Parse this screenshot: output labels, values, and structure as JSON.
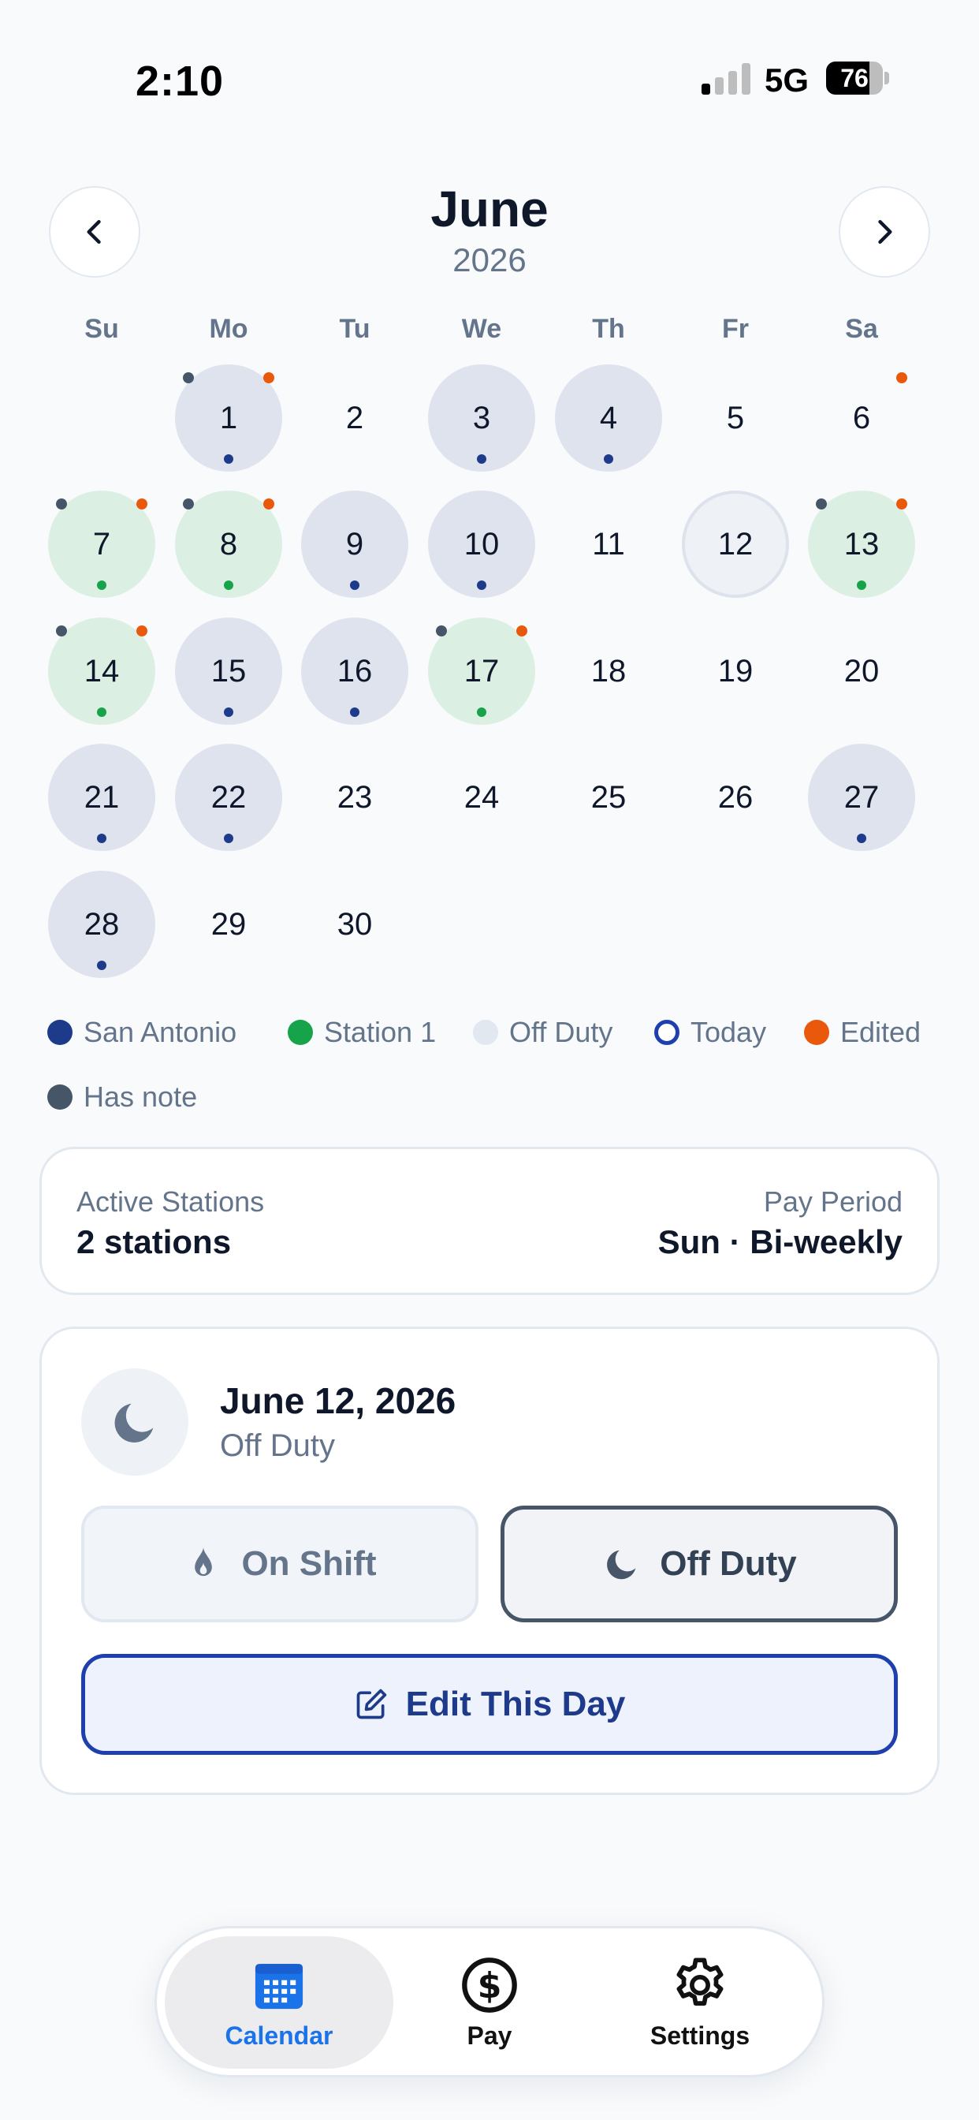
{
  "status_bar": {
    "time": "2:10",
    "network": "5G",
    "battery": "76",
    "battery_level": 0.76
  },
  "header": {
    "month": "June",
    "year": "2026"
  },
  "weekdays": [
    "Su",
    "Mo",
    "Tu",
    "We",
    "Th",
    "Fr",
    "Sa"
  ],
  "calendar": {
    "days": [
      {
        "n": "1",
        "type": "blue",
        "note": true,
        "edited": true
      },
      {
        "n": "2",
        "type": "none"
      },
      {
        "n": "3",
        "type": "blue"
      },
      {
        "n": "4",
        "type": "blue"
      },
      {
        "n": "5",
        "type": "none"
      },
      {
        "n": "6",
        "type": "none",
        "edited": true
      },
      {
        "n": "7",
        "type": "green",
        "note": true,
        "edited": true
      },
      {
        "n": "8",
        "type": "green",
        "note": true,
        "edited": true
      },
      {
        "n": "9",
        "type": "blue"
      },
      {
        "n": "10",
        "type": "blue"
      },
      {
        "n": "11",
        "type": "none"
      },
      {
        "n": "12",
        "type": "selected"
      },
      {
        "n": "13",
        "type": "green",
        "note": true,
        "edited": true
      },
      {
        "n": "14",
        "type": "green",
        "note": true,
        "edited": true
      },
      {
        "n": "15",
        "type": "blue"
      },
      {
        "n": "16",
        "type": "blue"
      },
      {
        "n": "17",
        "type": "green",
        "note": true,
        "edited": true
      },
      {
        "n": "18",
        "type": "none"
      },
      {
        "n": "19",
        "type": "none"
      },
      {
        "n": "20",
        "type": "none"
      },
      {
        "n": "21",
        "type": "blue"
      },
      {
        "n": "22",
        "type": "blue"
      },
      {
        "n": "23",
        "type": "none"
      },
      {
        "n": "24",
        "type": "none"
      },
      {
        "n": "25",
        "type": "none"
      },
      {
        "n": "26",
        "type": "none"
      },
      {
        "n": "27",
        "type": "blue"
      },
      {
        "n": "28",
        "type": "blue"
      },
      {
        "n": "29",
        "type": "none"
      },
      {
        "n": "30",
        "type": "none"
      }
    ],
    "first_weekday": 1
  },
  "legend": {
    "san_antonio": "San Antonio",
    "station1": "Station 1",
    "off_duty": "Off Duty",
    "today": "Today",
    "edited": "Edited",
    "has_note": "Has note"
  },
  "colors": {
    "san_antonio": "#1e3a8a",
    "station1": "#16a34a",
    "off_duty": "#e2e8f0",
    "today": "#1e40af",
    "edited": "#ea580c",
    "note": "#475569"
  },
  "info": {
    "active_label": "Active Stations",
    "active_value": "2 stations",
    "pay_label": "Pay Period",
    "pay_value": "Sun · Bi-weekly"
  },
  "detail": {
    "icon": "moon-icon",
    "date": "June 12, 2026",
    "status": "Off Duty",
    "on_shift_label": "On Shift",
    "off_duty_label": "Off Duty",
    "edit_label": "Edit This Day"
  },
  "tabs": [
    {
      "label": "Calendar",
      "icon": "calendar-icon",
      "active": true
    },
    {
      "label": "Pay",
      "icon": "dollar-icon",
      "active": false
    },
    {
      "label": "Settings",
      "icon": "gear-icon",
      "active": false
    }
  ]
}
